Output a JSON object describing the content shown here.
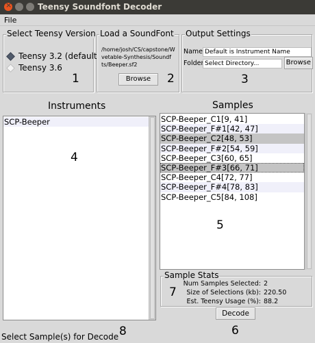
{
  "window": {
    "title": "Teensy Soundfont Decoder"
  },
  "menu": {
    "file": "File"
  },
  "teensy": {
    "title": "Select Teensy Version",
    "options": [
      {
        "label": "Teensy 3.2 (default"
      },
      {
        "label": "Teensy 3.6"
      }
    ],
    "selected_index": 0,
    "number": "1"
  },
  "soundfont": {
    "title": "Load a SoundFont",
    "path_lines": [
      "/home/josh/CS/capstone/W",
      "vetable-Synthesis/Soundf",
      "ts/Beeper.sf2"
    ],
    "browse_label": "Browse",
    "number": "2"
  },
  "output": {
    "title": "Output Settings",
    "name_label": "Name",
    "name_value": "Default is Instrument Name",
    "folder_label": "Folder",
    "folder_value": "Select Directory...",
    "browse_label": "Browse",
    "number": "3"
  },
  "instruments": {
    "heading": "Instruments",
    "items": [
      "SCP-Beeper"
    ],
    "number": "4"
  },
  "samples": {
    "heading": "Samples",
    "items": [
      {
        "label": "SCP-Beeper_C1[9, 41]",
        "selected": false
      },
      {
        "label": "SCP-Beeper_F#1[42, 47]",
        "selected": false
      },
      {
        "label": "SCP-Beeper_C2[48, 53]",
        "selected": true
      },
      {
        "label": "SCP-Beeper_F#2[54, 59]",
        "selected": false
      },
      {
        "label": "SCP-Beeper_C3[60, 65]",
        "selected": false
      },
      {
        "label": "SCP-Beeper_F#3[66, 71]",
        "selected": true
      },
      {
        "label": "SCP-Beeper_C4[72, 77]",
        "selected": false
      },
      {
        "label": "SCP-Beeper_F#4[78, 83]",
        "selected": false
      },
      {
        "label": "SCP-Beeper_C5[84, 108]",
        "selected": false
      }
    ],
    "number": "5"
  },
  "stats": {
    "title": "Sample Stats",
    "rows": [
      {
        "label": "Num Samples Selected:",
        "value": "2"
      },
      {
        "label": "Size of Selections (kb):",
        "value": "220.50"
      },
      {
        "label": "Est. Teensy Usage (%):",
        "value": "88.2"
      }
    ],
    "number": "7"
  },
  "decode": {
    "label": "Decode",
    "number": "6"
  },
  "status": {
    "text": "Select Sample(s) for Decode",
    "number": "8"
  }
}
